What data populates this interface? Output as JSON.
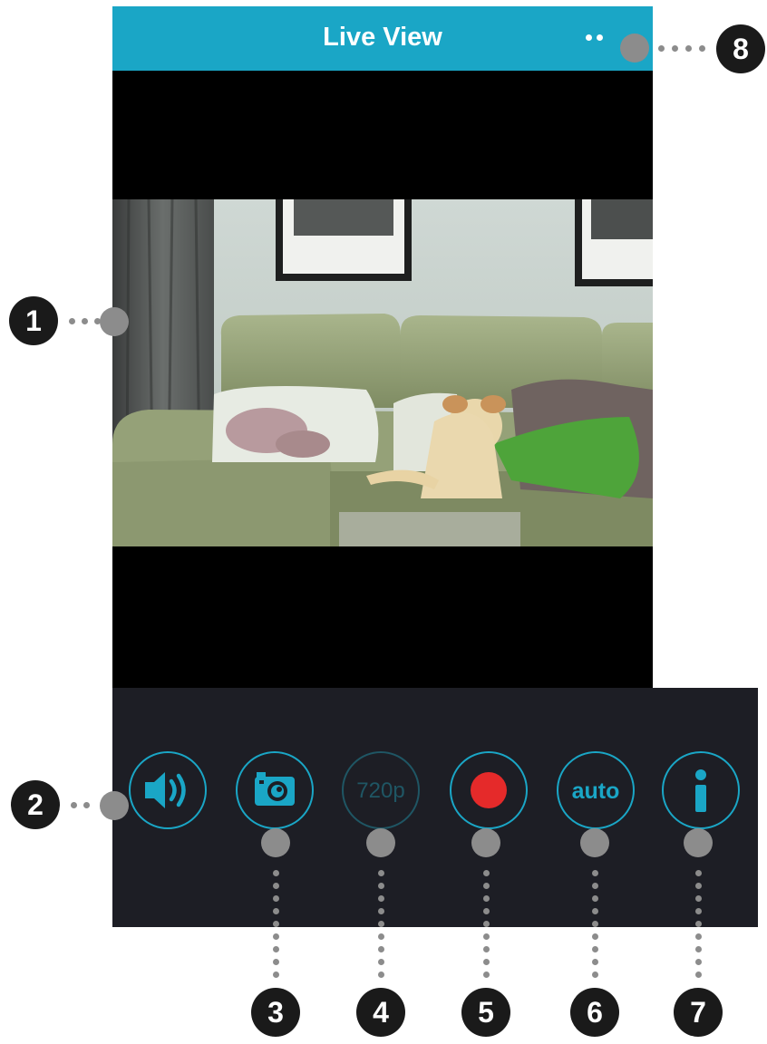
{
  "header": {
    "title": "Live View"
  },
  "icons": {
    "menu": "more-options-icon",
    "audio": "speaker-icon",
    "snapshot": "camera-icon",
    "record": "record-icon",
    "info": "info-icon"
  },
  "controls": {
    "resolution_label": "720p",
    "night_mode_label": "auto"
  },
  "callouts": [
    "1",
    "2",
    "3",
    "4",
    "5",
    "6",
    "7",
    "8"
  ],
  "colors": {
    "accent": "#1aa6c6",
    "record": "#e52a2a",
    "bar": "#1d1e25",
    "callout": "#8c8c8c"
  }
}
